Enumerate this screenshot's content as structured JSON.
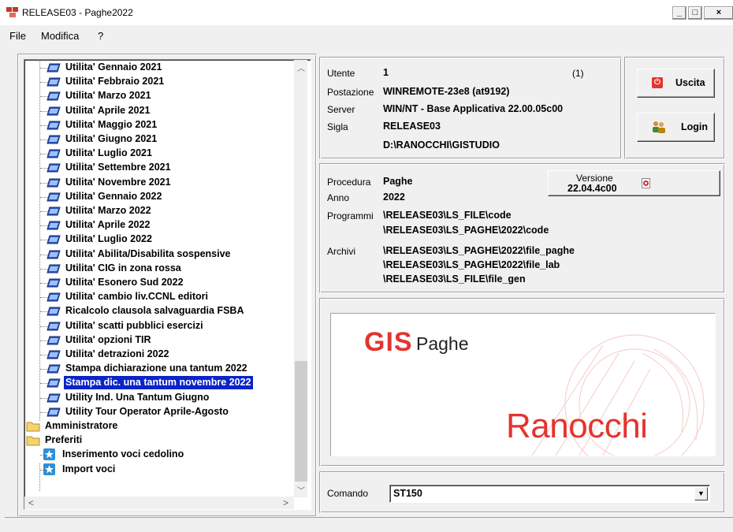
{
  "window": {
    "title": "RELEASE03 - Paghe2022",
    "minimize": "_",
    "maximize": "□",
    "close": "×"
  },
  "menu": [
    "File",
    "Modifica",
    "?"
  ],
  "tree": {
    "items": [
      {
        "label": "Utilita' Gennaio  2021",
        "type": "program",
        "level": 2
      },
      {
        "label": "Utilita' Febbraio 2021",
        "type": "program",
        "level": 2
      },
      {
        "label": "Utilita' Marzo 2021",
        "type": "program",
        "level": 2
      },
      {
        "label": "Utilita' Aprile 2021",
        "type": "program",
        "level": 2
      },
      {
        "label": "Utilita' Maggio 2021",
        "type": "program",
        "level": 2
      },
      {
        "label": "Utilita' Giugno 2021",
        "type": "program",
        "level": 2
      },
      {
        "label": "Utilita' Luglio 2021",
        "type": "program",
        "level": 2
      },
      {
        "label": "Utilita' Settembre 2021",
        "type": "program",
        "level": 2
      },
      {
        "label": "Utilita' Novembre 2021",
        "type": "program",
        "level": 2
      },
      {
        "label": "Utilita' Gennaio 2022",
        "type": "program",
        "level": 2
      },
      {
        "label": "Utilita' Marzo 2022",
        "type": "program",
        "level": 2
      },
      {
        "label": "Utilita' Aprile 2022",
        "type": "program",
        "level": 2
      },
      {
        "label": "Utilita' Luglio 2022",
        "type": "program",
        "level": 2
      },
      {
        "label": "Utilita' Abilita/Disabilita sospensive",
        "type": "program",
        "level": 2
      },
      {
        "label": "Utilita' CIG in zona rossa",
        "type": "program",
        "level": 2
      },
      {
        "label": "Utilita' Esonero Sud 2022",
        "type": "program",
        "level": 2
      },
      {
        "label": "Utilita' cambio liv.CCNL editori",
        "type": "program",
        "level": 2
      },
      {
        "label": "Ricalcolo clausola salvaguardia FSBA",
        "type": "program",
        "level": 2
      },
      {
        "label": "Utilita' scatti pubblici esercizi",
        "type": "program",
        "level": 2
      },
      {
        "label": "Utilita' opzioni TIR",
        "type": "program",
        "level": 2
      },
      {
        "label": "Utilita' detrazioni 2022",
        "type": "program",
        "level": 2
      },
      {
        "label": "Stampa dichiarazione una tantum 2022",
        "type": "program",
        "level": 2
      },
      {
        "label": "Stampa dic. una tantum novembre 2022",
        "type": "program",
        "level": 2,
        "selected": true
      },
      {
        "label": "Utility Ind. Una Tantum Giugno",
        "type": "program",
        "level": 2
      },
      {
        "label": "Utility Tour Operator Aprile-Agosto",
        "type": "program",
        "level": 2
      },
      {
        "label": "Amministratore",
        "type": "folder",
        "level": 0
      },
      {
        "label": "Preferiti",
        "type": "folder-open",
        "level": 0
      },
      {
        "label": "Inserimento voci cedolino",
        "type": "favorite",
        "level": 1
      },
      {
        "label": "Import voci",
        "type": "favorite",
        "level": 1
      }
    ]
  },
  "user_panel": {
    "utente_label": "Utente",
    "utente_value": "1",
    "utente_count": "(1)",
    "postazione_label": "Postazione",
    "postazione_value": "WINREMOTE-23e8 (at9192)",
    "server_label": "Server",
    "server_value": "WIN/NT - Base Applicativa 22.00.05c00",
    "sigla_label": "Sigla",
    "sigla_value": "RELEASE03",
    "path_value": "D:\\RANOCCHI\\GISTUDIO"
  },
  "buttons": {
    "uscita": "Uscita",
    "login": "Login"
  },
  "proc_panel": {
    "procedura_label": "Procedura",
    "procedura_value": "Paghe",
    "anno_label": "Anno",
    "anno_value": "2022",
    "programmi_label": "Programmi",
    "programmi_values": [
      "\\RELEASE03\\LS_FILE\\code",
      "\\RELEASE03\\LS_PAGHE\\2022\\code"
    ],
    "archivi_label": "Archivi",
    "archivi_values": [
      "\\RELEASE03\\LS_PAGHE\\2022\\file_paghe",
      "\\RELEASE03\\LS_PAGHE\\2022\\file_lab",
      "\\RELEASE03\\LS_FILE\\file_gen"
    ],
    "versione_label": "Versione",
    "versione_value": "22.04.4c00"
  },
  "logo": {
    "brand_mark": "GIS",
    "product": "Paghe",
    "company": "Ranocchi"
  },
  "command": {
    "label": "Comando",
    "value": "ST150"
  },
  "colors": {
    "selection": "#0a24c8",
    "brand_red": "#e3342f"
  }
}
